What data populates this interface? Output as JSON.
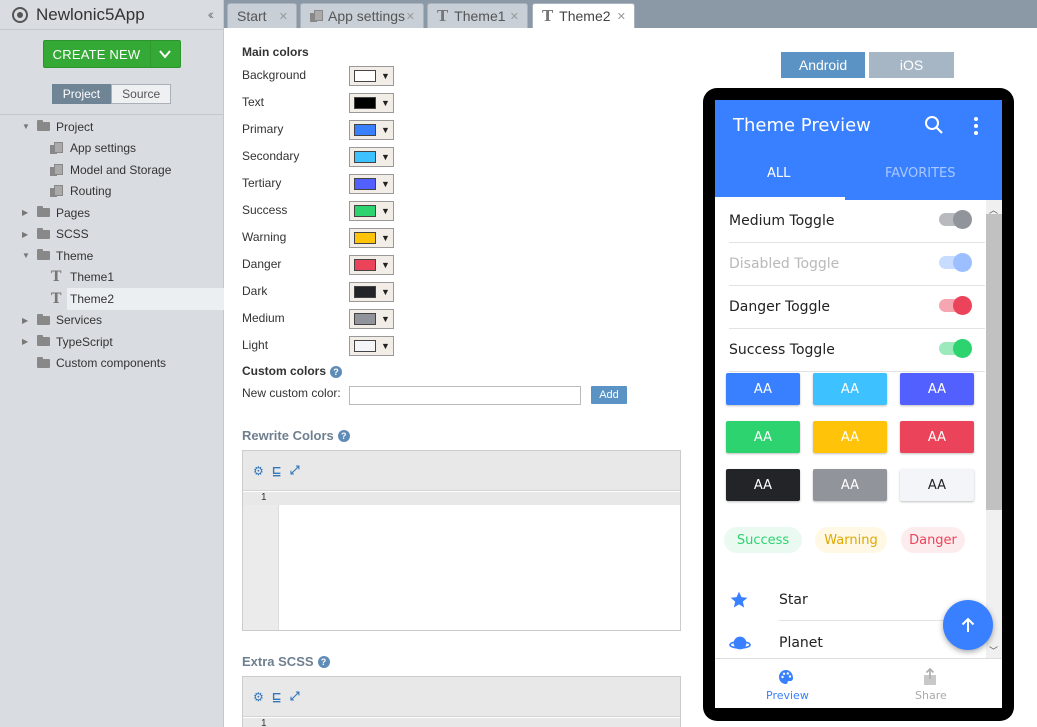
{
  "app": {
    "title": "Newlonic5App"
  },
  "sidebar": {
    "create_label": "CREATE NEW",
    "tabs": [
      "Project",
      "Source"
    ],
    "tree": [
      {
        "label": "Project",
        "kind": "folder",
        "expanded": true
      },
      {
        "label": "App settings",
        "kind": "file"
      },
      {
        "label": "Model and Storage",
        "kind": "file"
      },
      {
        "label": "Routing",
        "kind": "file"
      },
      {
        "label": "Pages",
        "kind": "folder"
      },
      {
        "label": "SCSS",
        "kind": "folder"
      },
      {
        "label": "Theme",
        "kind": "folder",
        "expanded": true
      },
      {
        "label": "Theme1",
        "kind": "theme"
      },
      {
        "label": "Theme2",
        "kind": "theme",
        "selected": true
      },
      {
        "label": "Services",
        "kind": "folder"
      },
      {
        "label": "TypeScript",
        "kind": "folder"
      },
      {
        "label": "Custom components",
        "kind": "folder"
      }
    ]
  },
  "doc_tabs": [
    {
      "label": "Start"
    },
    {
      "label": "App settings"
    },
    {
      "label": "Theme1"
    },
    {
      "label": "Theme2",
      "active": true
    }
  ],
  "main": {
    "main_colors_title": "Main colors",
    "colors": [
      {
        "label": "Background",
        "color": "#ffffff"
      },
      {
        "label": "Text",
        "color": "#000000"
      },
      {
        "label": "Primary",
        "color": "#3880ff"
      },
      {
        "label": "Secondary",
        "color": "#3dc2ff"
      },
      {
        "label": "Tertiary",
        "color": "#5260ff"
      },
      {
        "label": "Success",
        "color": "#2dd36f"
      },
      {
        "label": "Warning",
        "color": "#ffc409"
      },
      {
        "label": "Danger",
        "color": "#eb445a"
      },
      {
        "label": "Dark",
        "color": "#222428"
      },
      {
        "label": "Medium",
        "color": "#92949c"
      },
      {
        "label": "Light",
        "color": "#f4f5f8"
      }
    ],
    "custom_colors_title": "Custom colors",
    "new_custom_label": "New custom color:",
    "new_custom_value": "",
    "add_label": "Add",
    "rewrite_title": "Rewrite Colors",
    "extra_title": "Extra SCSS",
    "help_glyph": "?",
    "line_number": "1"
  },
  "platform": {
    "android": "Android",
    "ios": "iOS"
  },
  "preview": {
    "title": "Theme Preview",
    "tabs": [
      "ALL",
      "FAVORITES"
    ],
    "toggles": [
      {
        "label": "Medium Toggle",
        "track": "#b9babd",
        "knob": "#92949c",
        "disabled": false
      },
      {
        "label": "Disabled Toggle",
        "track": "#c8dcff",
        "knob": "#9cc0ff",
        "disabled": true
      },
      {
        "label": "Danger Toggle",
        "track": "#f5a6b1",
        "knob": "#eb445a",
        "disabled": false
      },
      {
        "label": "Success Toggle",
        "track": "#9ce9bb",
        "knob": "#2dd36f",
        "disabled": false
      }
    ],
    "buttons": [
      {
        "label": "AA",
        "bg": "#3880ff",
        "fg": "#ffffff"
      },
      {
        "label": "AA",
        "bg": "#3dc2ff",
        "fg": "#ffffff"
      },
      {
        "label": "AA",
        "bg": "#5260ff",
        "fg": "#ffffff"
      },
      {
        "label": "AA",
        "bg": "#2dd36f",
        "fg": "#ffffff"
      },
      {
        "label": "AA",
        "bg": "#ffc409",
        "fg": "#ffffff"
      },
      {
        "label": "AA",
        "bg": "#eb445a",
        "fg": "#ffffff"
      },
      {
        "label": "AA",
        "bg": "#222428",
        "fg": "#ffffff"
      },
      {
        "label": "AA",
        "bg": "#92949c",
        "fg": "#ffffff"
      },
      {
        "label": "AA",
        "bg": "#f4f5f8",
        "fg": "#222222"
      }
    ],
    "chips": [
      {
        "label": "Success",
        "bg": "#eafaf1",
        "fg": "#2dd36f"
      },
      {
        "label": "Warning",
        "bg": "#fff8e5",
        "fg": "#e0a800"
      },
      {
        "label": "Danger",
        "bg": "#fdecee",
        "fg": "#eb445a"
      }
    ],
    "list": [
      {
        "label": "Star",
        "icon": "star-icon"
      },
      {
        "label": "Planet",
        "icon": "planet-icon"
      }
    ],
    "bottom_tabs": [
      {
        "label": "Preview",
        "icon": "palette-icon",
        "active": true
      },
      {
        "label": "Share",
        "icon": "share-icon",
        "active": false
      }
    ]
  }
}
